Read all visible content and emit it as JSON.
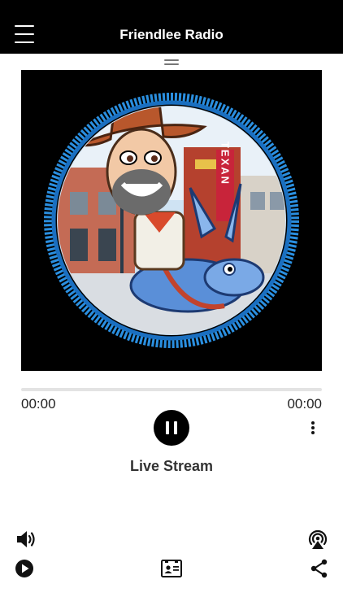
{
  "header": {
    "title": "Friendlee Radio",
    "menu_icon": "hamburger-menu-icon"
  },
  "player": {
    "elapsed": "00:00",
    "duration": "00:00",
    "progress": 0,
    "state": "playing",
    "track_title": "Live Stream",
    "artwork_sign_text": "TEXAN"
  },
  "bottom_bar": {
    "icons": [
      "volume-icon",
      "airplay-icon",
      "play-circle-icon",
      "contact-card-icon",
      "share-icon"
    ]
  },
  "colors": {
    "header_bg": "#000000",
    "background": "#ffffff",
    "artwork_ring": "#2a8fe0",
    "progress_track": "#e3e3e3"
  }
}
